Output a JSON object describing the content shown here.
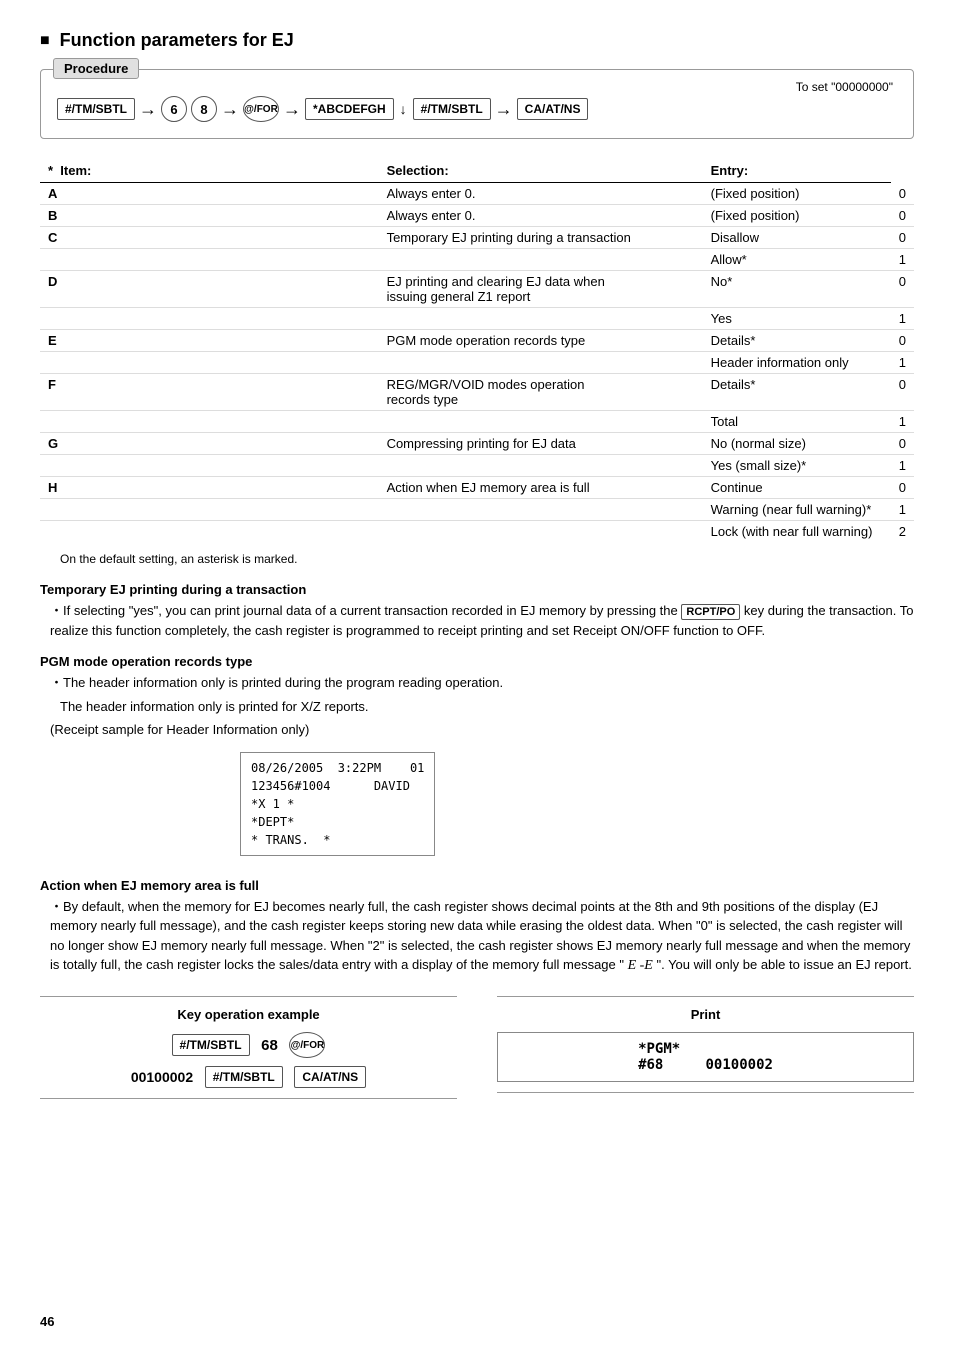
{
  "page": {
    "title": "Function parameters for EJ",
    "page_number": "46"
  },
  "procedure": {
    "label": "Procedure",
    "note": "To set \"00000000\"",
    "flow": [
      {
        "type": "key",
        "text": "#/TM/SBTL"
      },
      {
        "type": "arrow"
      },
      {
        "type": "circle",
        "text": "6"
      },
      {
        "type": "circle",
        "text": "8"
      },
      {
        "type": "arrow"
      },
      {
        "type": "key-circle",
        "text": "@/FOR"
      },
      {
        "type": "arrow"
      },
      {
        "type": "key",
        "text": "*ABCDEFGH"
      },
      {
        "type": "arrow-down"
      },
      {
        "type": "key",
        "text": "#/TM/SBTL"
      },
      {
        "type": "arrow"
      },
      {
        "type": "key",
        "text": "CA/AT/NS"
      }
    ]
  },
  "table": {
    "headers": {
      "item": "* Item:",
      "selection": "Selection:",
      "entry": "Entry:"
    },
    "rows": [
      {
        "letter": "A",
        "item": "Always enter 0.",
        "selection": "(Fixed position)",
        "entry": "0",
        "first_row": true
      },
      {
        "letter": "B",
        "item": "Always enter 0.",
        "selection": "(Fixed position)",
        "entry": "0",
        "first_row": true
      },
      {
        "letter": "C",
        "item": "Temporary EJ printing during a transaction",
        "selection": "Disallow",
        "entry": "0",
        "first_row": true
      },
      {
        "letter": "",
        "item": "",
        "selection": "Allow*",
        "entry": "1",
        "first_row": false
      },
      {
        "letter": "D",
        "item": "EJ printing and clearing EJ data when issuing general Z1 report",
        "selection": "No*",
        "entry": "0",
        "first_row": true
      },
      {
        "letter": "",
        "item": "",
        "selection": "Yes",
        "entry": "1",
        "first_row": false
      },
      {
        "letter": "E",
        "item": "PGM mode operation records type",
        "selection": "Details*",
        "entry": "0",
        "first_row": true
      },
      {
        "letter": "",
        "item": "",
        "selection": "Header information only",
        "entry": "1",
        "first_row": false
      },
      {
        "letter": "F",
        "item": "REG/MGR/VOID modes operation records type",
        "selection": "Details*",
        "entry": "0",
        "first_row": true
      },
      {
        "letter": "",
        "item": "",
        "selection": "Total",
        "entry": "1",
        "first_row": false
      },
      {
        "letter": "G",
        "item": "Compressing printing for EJ data",
        "selection": "No (normal size)",
        "entry": "0",
        "first_row": true
      },
      {
        "letter": "",
        "item": "",
        "selection": "Yes (small size)*",
        "entry": "1",
        "first_row": false
      },
      {
        "letter": "H",
        "item": "Action when EJ memory area is full",
        "selection": "Continue",
        "entry": "0",
        "first_row": true
      },
      {
        "letter": "",
        "item": "",
        "selection": "Warning (near full warning)*",
        "entry": "1",
        "first_row": false
      },
      {
        "letter": "",
        "item": "",
        "selection": "Lock (with near full warning)",
        "entry": "2",
        "first_row": false
      }
    ]
  },
  "asterisk_note": "On the default setting, an asterisk is marked.",
  "subsections": [
    {
      "id": "temp_ej",
      "title": "Temporary EJ printing during a transaction",
      "content": [
        "If selecting \"yes\", you can print journal data of a current transaction recorded in EJ memory by pressing the",
        "key during the transaction.  To realize this function completely, the cash register is programmed to receipt printing and set Receipt ON/OFF function to OFF."
      ]
    },
    {
      "id": "pgm_mode",
      "title": "PGM mode operation records type",
      "content": [
        "The header information only is printed during the program reading operation.",
        "The header information only is printed for X/Z reports.",
        "(Receipt sample for Header Information only)"
      ]
    },
    {
      "id": "action_ej",
      "title": "Action when EJ memory area is full",
      "content": [
        "By default, when the memory for EJ becomes nearly full, the cash register shows decimal points at the 8th and 9th positions of the display (EJ memory nearly full message), and the cash register keeps storing new data while erasing the oldest data.  When \"0\" is selected, the cash register will no longer show EJ memory nearly full message.  When \"2\" is selected, the cash register shows EJ memory nearly full message and when the memory is totally full, the cash register locks the sales/data entry with a display of the memory full message \" E -E \".  You will only be able to issue an EJ report."
      ]
    }
  ],
  "receipt_sample": {
    "lines": [
      "08/26/2005  3:22PM    01",
      "123456#1004      DAVID",
      "*X 1 *",
      "*DEPT*",
      "* TRANS.  *"
    ]
  },
  "key_operation": {
    "title": "Key operation example",
    "flow1": [
      "#/TM/SBTL",
      "68",
      "@/FOR"
    ],
    "flow2": [
      "00100002",
      "#/TM/SBTL",
      "CA/AT/NS"
    ]
  },
  "print_example": {
    "title": "Print",
    "lines": [
      "*PGM*",
      "#68     00100002"
    ]
  }
}
